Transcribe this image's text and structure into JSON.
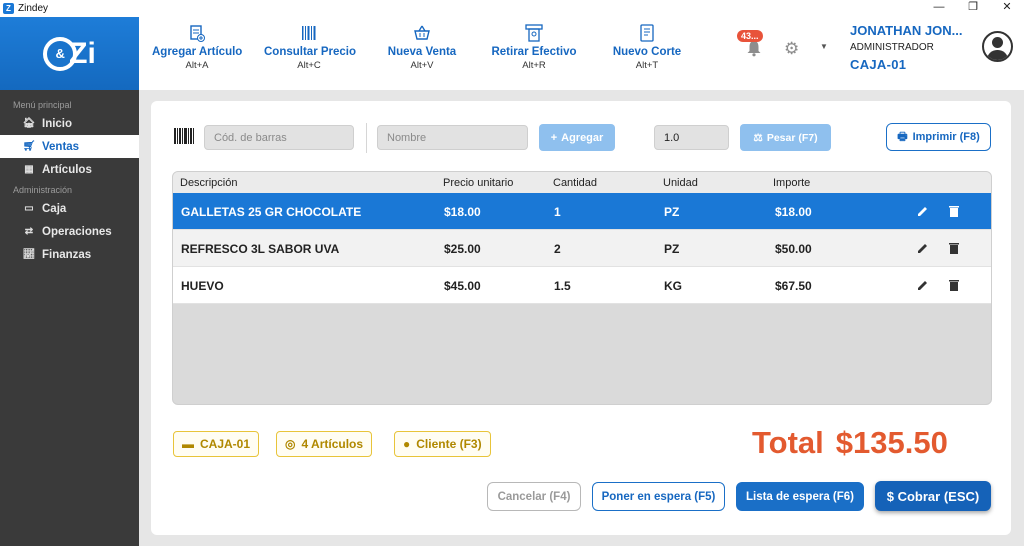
{
  "window": {
    "title": "Zindey",
    "controls": [
      "—",
      "❐",
      "✕"
    ]
  },
  "brand": {
    "logo_ring": "&",
    "logo_text": "Zi"
  },
  "sidebar": {
    "section_main": "Menú principal",
    "section_admin": "Administración",
    "items": [
      {
        "label": "Inicio",
        "icon": "home-icon"
      },
      {
        "label": "Ventas",
        "icon": "cart-icon",
        "active": true
      },
      {
        "label": "Artículos",
        "icon": "boxes-icon"
      },
      {
        "label": "Caja",
        "icon": "cash-drawer-icon"
      },
      {
        "label": "Operaciones",
        "icon": "exchange-icon"
      },
      {
        "label": "Finanzas",
        "icon": "chart-icon"
      }
    ]
  },
  "toolbar": {
    "actions": [
      {
        "label": "Agregar Artículo",
        "shortcut": "Alt+A",
        "icon": "add-item-icon"
      },
      {
        "label": "Consultar Precio",
        "shortcut": "Alt+C",
        "icon": "barcode-icon"
      },
      {
        "label": "Nueva Venta",
        "shortcut": "Alt+V",
        "icon": "basket-icon"
      },
      {
        "label": "Retirar Efectivo",
        "shortcut": "Alt+R",
        "icon": "cash-withdraw-icon"
      },
      {
        "label": "Nuevo Corte",
        "shortcut": "Alt+T",
        "icon": "receipt-icon"
      }
    ],
    "notifications_badge": "43..."
  },
  "user": {
    "name": "JONATHAN JON...",
    "role": "ADMINISTRADOR",
    "register": "CAJA-01"
  },
  "entry": {
    "barcode_placeholder": "Cód. de barras",
    "name_placeholder": "Nombre",
    "add_label": "Agregar",
    "quantity_value": "1.0",
    "weigh_label": "Pesar (F7)",
    "print_label": "Imprimir (F8)"
  },
  "table": {
    "columns": [
      "Descripción",
      "Precio unitario",
      "Cantidad",
      "Unidad",
      "Importe"
    ],
    "rows": [
      {
        "description": "GALLETAS 25 GR CHOCOLATE",
        "unit_price": "$18.00",
        "quantity": "1",
        "unit": "PZ",
        "amount": "$18.00",
        "selected": true
      },
      {
        "description": "REFRESCO 3L SABOR UVA",
        "unit_price": "$25.00",
        "quantity": "2",
        "unit": "PZ",
        "amount": "$50.00"
      },
      {
        "description": "HUEVO",
        "unit_price": "$45.00",
        "quantity": "1.5",
        "unit": "KG",
        "amount": "$67.50"
      }
    ]
  },
  "summary": {
    "register_chip": "CAJA-01",
    "items_chip": "4 Artículos",
    "client_chip": "Cliente (F3)",
    "total_label": "Total",
    "total_amount": "$135.50"
  },
  "actions": {
    "cancel": "Cancelar (F4)",
    "hold": "Poner en espera (F5)",
    "hold_list": "Lista de espera (F6)",
    "charge": "$ Cobrar (ESC)"
  },
  "colors": {
    "primary": "#1667c0",
    "total": "#e35a2f",
    "chip_border": "#e8c43a",
    "sidebar": "#3a3a3a"
  }
}
